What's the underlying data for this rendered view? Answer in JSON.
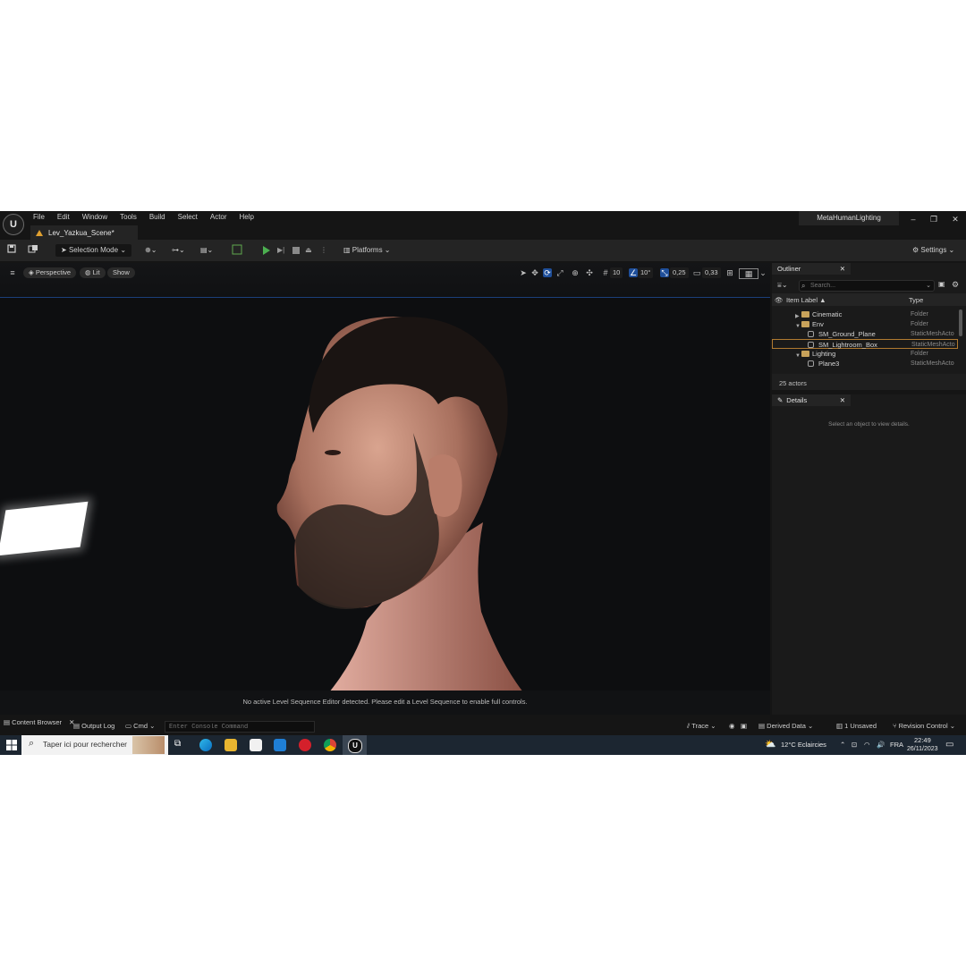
{
  "window": {
    "logo_text": "U",
    "project_name": "MetaHumanLighting",
    "level_tab": "Lev_Yazkua_Scene*",
    "controls": {
      "minimize": "–",
      "restore": "❐",
      "close": "✕"
    }
  },
  "menu": [
    "File",
    "Edit",
    "Window",
    "Tools",
    "Build",
    "Select",
    "Actor",
    "Help"
  ],
  "toolbar": {
    "selection_mode": "Selection Mode",
    "platforms": "Platforms",
    "settings": "Settings"
  },
  "viewport": {
    "perspective": "Perspective",
    "lit": "Lit",
    "show": "Show",
    "grid_snap": "10",
    "rotation_snap": "10°",
    "scale_snap": "0,25",
    "camera_speed": "0,33",
    "sequence_message": "No active Level Sequence Editor detected. Please edit a Level Sequence to enable full controls."
  },
  "outliner": {
    "tab_label": "Outliner",
    "search_placeholder": "Search...",
    "col_label": "Item Label ▲",
    "col_type": "Type",
    "rows": [
      {
        "label": "Cinematic",
        "type": "Folder"
      },
      {
        "label": "Env",
        "type": "Folder"
      },
      {
        "label": "SM_Ground_Plane",
        "type": "StaticMeshActo"
      },
      {
        "label": "SM_Lightroom_Box",
        "type": "StaticMeshActo"
      },
      {
        "label": "Lighting",
        "type": "Folder"
      },
      {
        "label": "Plane3",
        "type": "StaticMeshActo"
      }
    ],
    "actor_count": "25 actors"
  },
  "details": {
    "tab_label": "Details",
    "empty_message": "Select an object to view details."
  },
  "statusbar": {
    "content_browser": "Content Browser",
    "output_log": "Output Log",
    "cmd": "Cmd",
    "console_placeholder": "Enter Console Command",
    "trace": "Trace",
    "derived_data": "Derived Data",
    "unsaved": "1 Unsaved",
    "revision_control": "Revision Control"
  },
  "taskbar": {
    "search_text": "Taper ici pour rechercher",
    "weather": "12°C  Eclaircies",
    "language": "FRA",
    "time": "22:49",
    "date": "26/11/2023"
  }
}
